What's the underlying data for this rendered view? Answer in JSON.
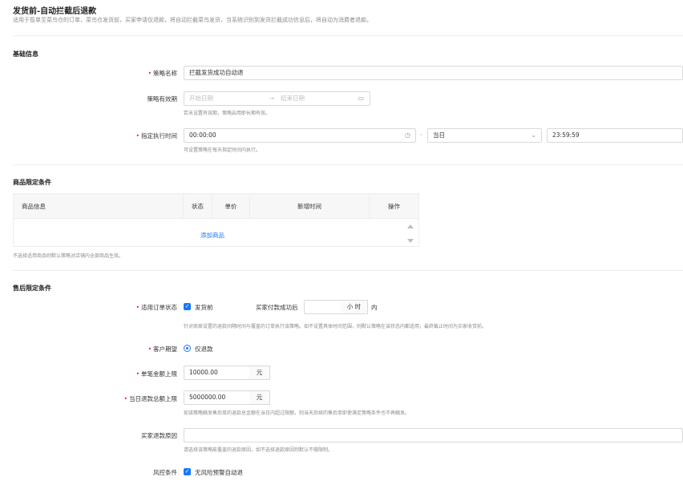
{
  "header": {
    "title": "发货前-自动拦截后退款",
    "description": "适用于揽单至菜鸟仓的订单，菜鸟仓发货前，买家申请仅退款，将自动拦截菜鸟发货，当系统识别到发货拦截成功信息后，将自动为消费者退款。"
  },
  "basic": {
    "section_title": "基础信息",
    "policy_name": {
      "label": "策略名称",
      "value": "拦截发货成功自动退"
    },
    "validity": {
      "label": "策略有效期",
      "start_placeholder": "开始日期",
      "arrow": "→",
      "end_placeholder": "结束日期",
      "hint": "若未设置有效期，策略启用即长期有效。",
      "icon": "calendar-icon"
    },
    "exec_time": {
      "label": "指定执行时间",
      "start_time": "00:00:00",
      "separator": "-",
      "day_option": "当日",
      "end_time": "23:59:59",
      "hint": "可设置策略在每天指定时间内执行。",
      "icon": "clock-icon"
    }
  },
  "goods": {
    "section_title": "商品限定条件",
    "columns": [
      "商品信息",
      "状态",
      "单价",
      "新增时间",
      "操作"
    ],
    "add_link": "添加商品",
    "footer_hint": "不选择适用商品则默认策略对店铺内全部商品生效。"
  },
  "aftersale": {
    "section_title": "售后限定条件",
    "order_status": {
      "label": "适用订单状态",
      "option": "发货前",
      "pay_label": "买家付款成功后",
      "pay_value": "",
      "unit": "小 时",
      "suffix": "内",
      "hint": "针对商家设置的退款间隔时间与覆盖的订单执行该策略。如不设置具体时间范围，则默认策略在该状态内都适用，最终截止时间为买家收货前。"
    },
    "customer_expect": {
      "label": "客户期望",
      "option": "仅退款"
    },
    "single_limit": {
      "label": "单笔金额上限",
      "value": "10000.00",
      "unit": "元"
    },
    "daily_limit": {
      "label": "当日退款总额上限",
      "value": "5000000.00",
      "unit": "元",
      "hint": "如该策略触发售后单的退款总金额在当日内超过限额，则当天后续的售后单即使满足策略条件也不再触发。"
    },
    "refund_reason": {
      "label": "买家退款原因",
      "value": "",
      "hint": "请选择该策略能覆盖的退款原因，如不选择退款原因则默认不做限制。"
    },
    "risk": {
      "label": "风控条件",
      "option": "无风险预警自动退"
    }
  },
  "colors": {
    "accent": "#1677ff",
    "required": "#f5222d"
  }
}
